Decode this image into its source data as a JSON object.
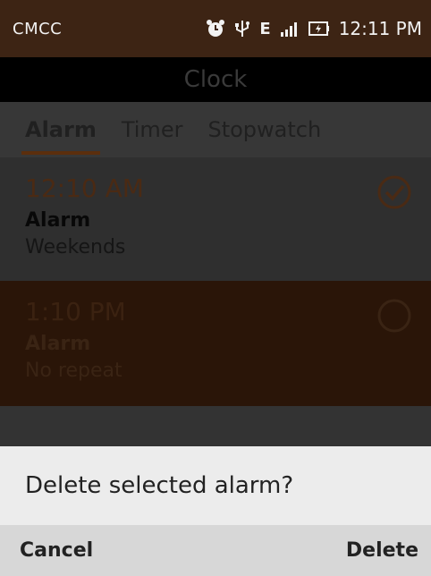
{
  "status_bar": {
    "carrier": "CMCC",
    "icons": [
      "alarm-icon",
      "usb-icon",
      "edge-network-icon",
      "signal-icon",
      "battery-charging-icon"
    ],
    "network": "E",
    "time": "12:11 PM"
  },
  "app_bar": {
    "title": "Clock"
  },
  "tabs": [
    {
      "label": "Alarm"
    },
    {
      "label": "Timer"
    },
    {
      "label": "Stopwatch"
    }
  ],
  "alarms": [
    {
      "time": "12:10 AM",
      "label": "Alarm",
      "repeat": "Weekends",
      "selected": true
    },
    {
      "time": "1:10 PM",
      "label": "Alarm",
      "repeat": "No repeat",
      "selected": false
    }
  ],
  "dialog": {
    "message": "Delete selected alarm?",
    "cancel_label": "Cancel",
    "delete_label": "Delete"
  },
  "colors": {
    "accent": "#5b2e0d",
    "status_bar_bg": "#3d2414",
    "dialog_bg": "#ececec"
  }
}
